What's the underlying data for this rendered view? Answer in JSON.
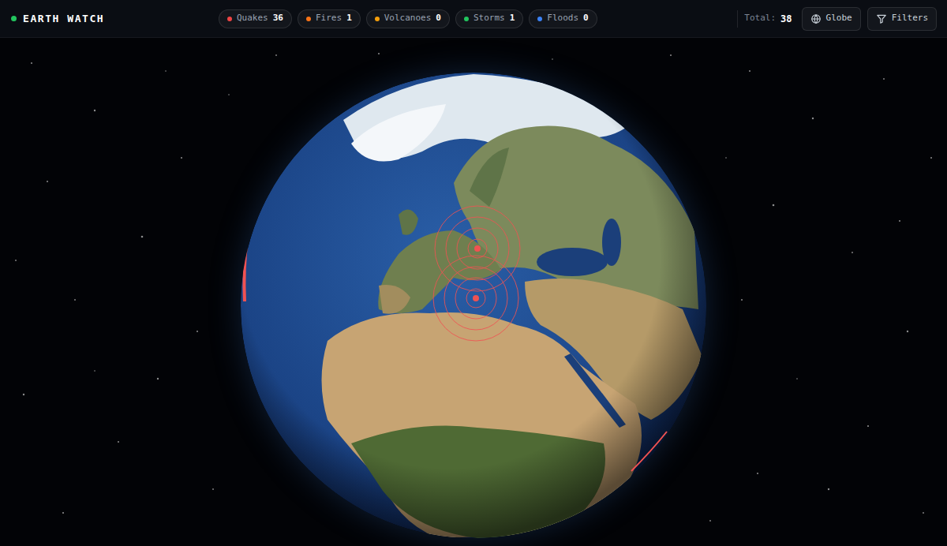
{
  "app": {
    "title": "EARTH WATCH",
    "status_color": "#22c55e"
  },
  "categories": [
    {
      "label": "Quakes",
      "count": "36",
      "color": "#ef4444"
    },
    {
      "label": "Fires",
      "count": "1",
      "color": "#f97316"
    },
    {
      "label": "Volcanoes",
      "count": "0",
      "color": "#f59e0b"
    },
    {
      "label": "Storms",
      "count": "1",
      "color": "#22c55e"
    },
    {
      "label": "Floods",
      "count": "0",
      "color": "#3b82f6"
    }
  ],
  "total": {
    "label": "Total:",
    "value": "38"
  },
  "buttons": [
    {
      "label": "Globe"
    },
    {
      "label": "Filters"
    }
  ]
}
